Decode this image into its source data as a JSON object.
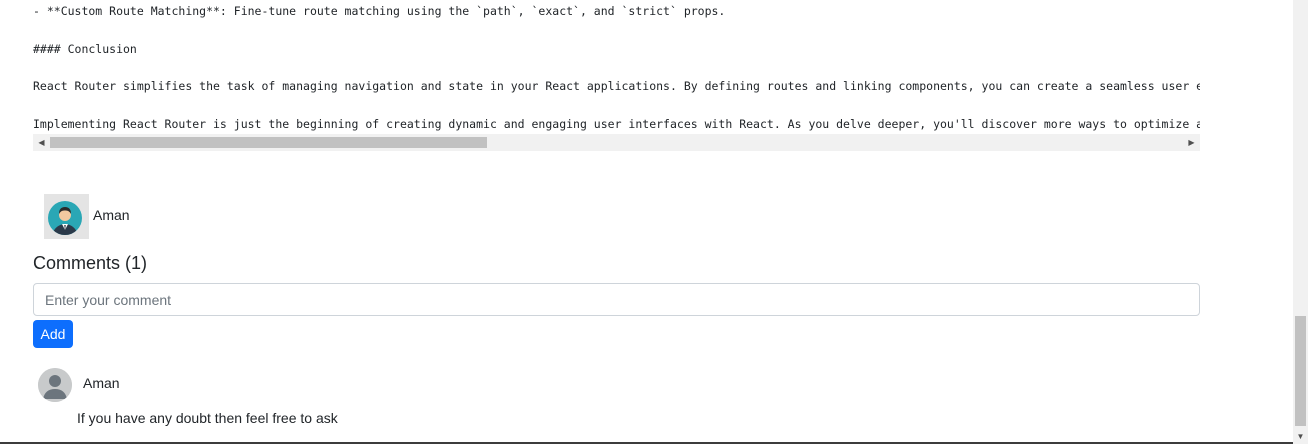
{
  "code": {
    "lines": [
      "- **Custom Route Matching**: Fine-tune route matching using the `path`, `exact`, and `strict` props.",
      "#### Conclusion",
      "React Router simplifies the task of managing navigation and state in your React applications. By defining routes and linking components, you can create a seamless user e",
      "Implementing React Router is just the beginning of creating dynamic and engaging user interfaces with React. As you delve deeper, you'll discover more ways to optimize a"
    ],
    "horizontal_scroll_fraction": 0.39
  },
  "author": {
    "name": "Aman"
  },
  "comments": {
    "heading": "Comments (1)",
    "input_placeholder": "Enter your comment",
    "add_label": "Add",
    "items": [
      {
        "author": "Aman",
        "text": "If you have any doubt then feel free to ask"
      }
    ]
  },
  "colors": {
    "primary_button": "#0d6efd",
    "avatar_teal": "#2aa7b5"
  },
  "icons": {
    "scroll_left": "scroll-left-arrow",
    "scroll_right": "scroll-right-arrow",
    "author_avatar": "user-avatar-icon",
    "comment_avatar": "default-user-icon"
  }
}
